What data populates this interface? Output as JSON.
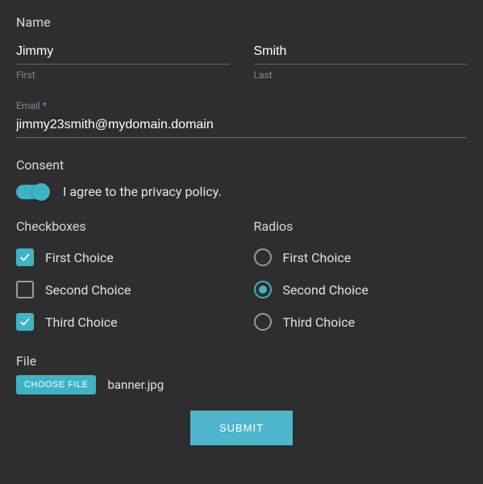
{
  "name": {
    "label": "Name",
    "first_value": "Jimmy",
    "first_sublabel": "First",
    "last_value": "Smith",
    "last_sublabel": "Last"
  },
  "email": {
    "label": "Email",
    "required_mark": "*",
    "value": "jimmy23smith@mydomain.domain"
  },
  "consent": {
    "label": "Consent",
    "text": "I agree to the privacy policy.",
    "on": true
  },
  "checkboxes": {
    "label": "Checkboxes",
    "options": [
      {
        "label": "First Choice",
        "checked": true
      },
      {
        "label": "Second Choice",
        "checked": false
      },
      {
        "label": "Third Choice",
        "checked": true
      }
    ]
  },
  "radios": {
    "label": "Radios",
    "options": [
      {
        "label": "First Choice",
        "checked": false
      },
      {
        "label": "Second Choice",
        "checked": true
      },
      {
        "label": "Third Choice",
        "checked": false
      }
    ]
  },
  "file": {
    "label": "File",
    "button": "CHOOSE FILE",
    "filename": "banner.jpg"
  },
  "submit": {
    "label": "SUBMIT"
  }
}
